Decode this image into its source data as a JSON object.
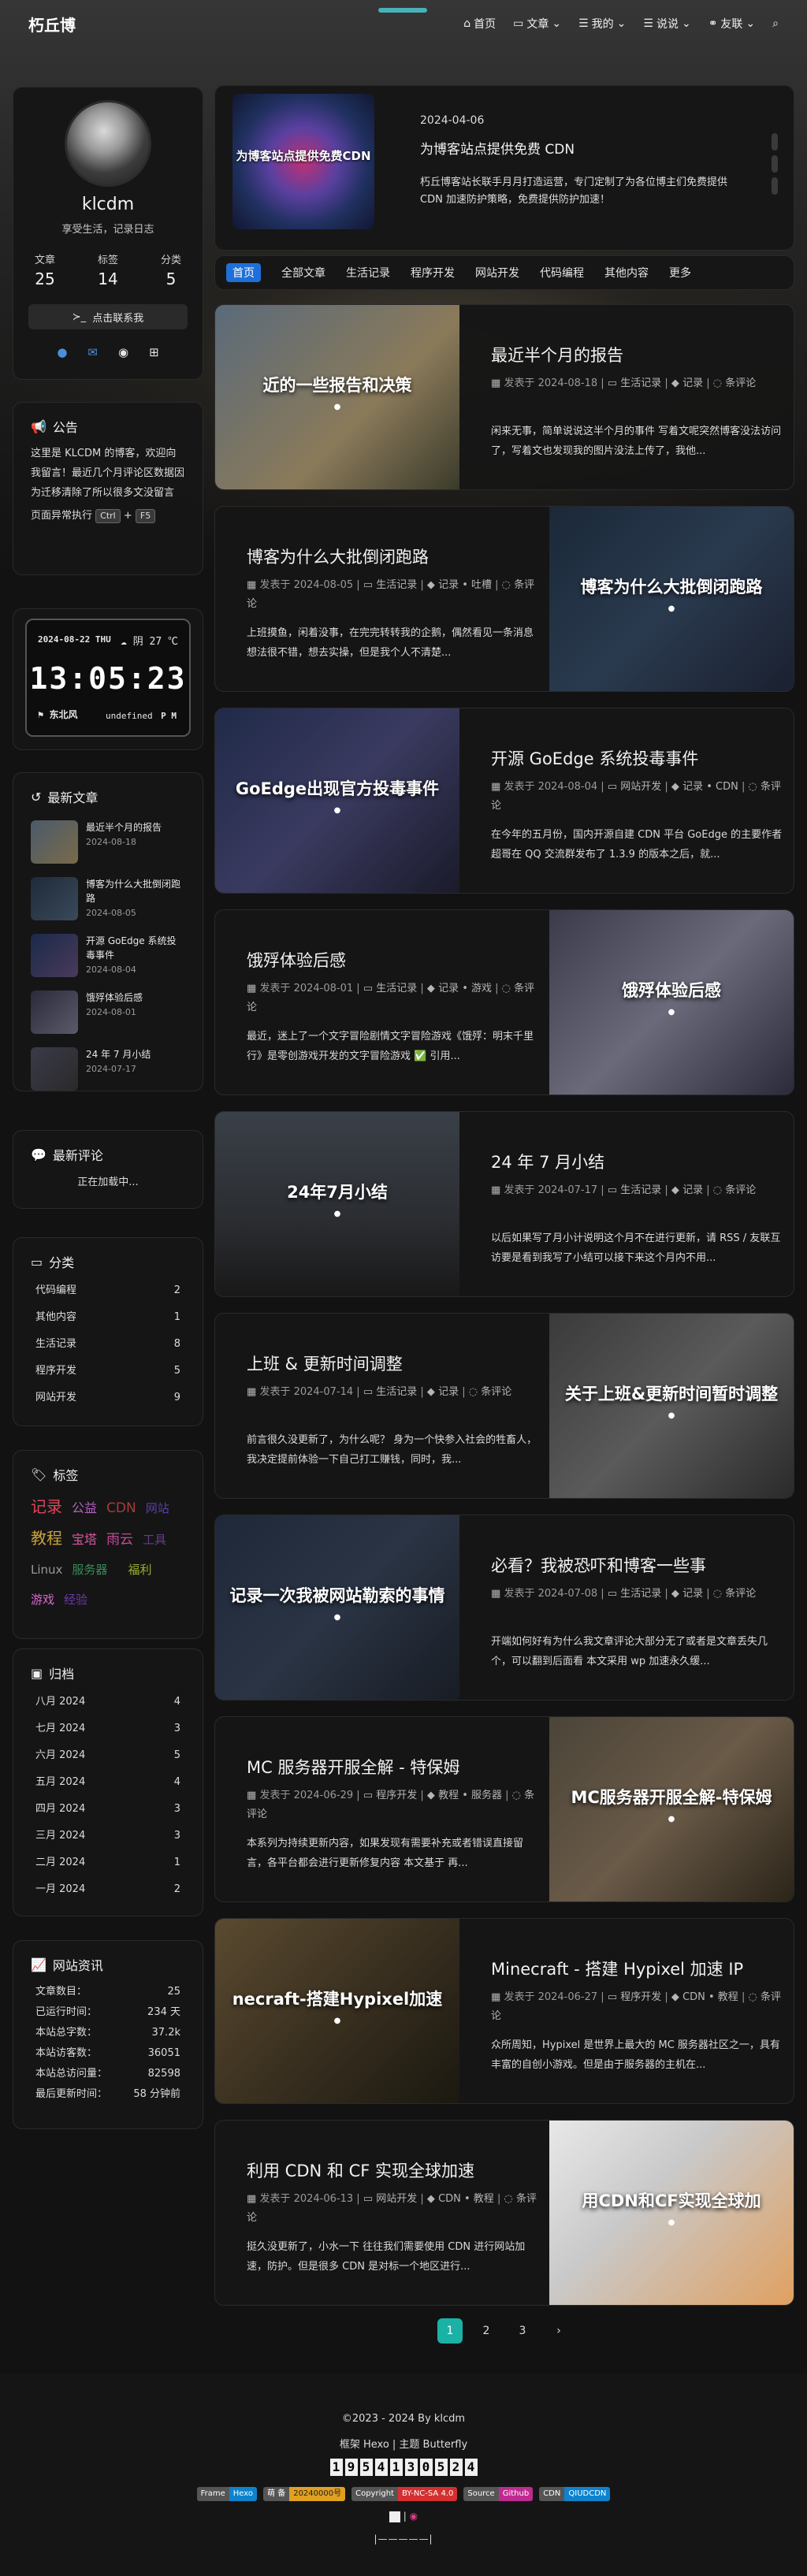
{
  "site": {
    "logo": "朽丘博"
  },
  "nav": {
    "items": [
      {
        "icon": "home-icon",
        "label": "首页"
      },
      {
        "icon": "folder-icon",
        "label": "文章"
      },
      {
        "icon": "list-icon",
        "label": "我的"
      },
      {
        "icon": "list-icon",
        "label": "说说"
      },
      {
        "icon": "link-icon",
        "label": "友联"
      }
    ]
  },
  "author": {
    "name": "klcdm",
    "desc": "享受生活，记录日志",
    "stats": [
      {
        "label": "文章",
        "value": "25"
      },
      {
        "label": "标签",
        "value": "14"
      },
      {
        "label": "分类",
        "value": "5"
      }
    ],
    "follow_label": "点击联系我"
  },
  "notice": {
    "title": "公告",
    "text": "这里是 KLCDM 的博客，欢迎向我留言！最近几个月评论区数据因为迁移清除了所以很多文没留言",
    "runtime_prefix": "页面异常执行",
    "key1": "Ctrl",
    "plus": "+",
    "key2": "F5"
  },
  "clock": {
    "date": "2024-08-22 THU",
    "weather": "阴 27 ℃",
    "time": "13:05:23",
    "wind": "东北风",
    "undef": "undefined",
    "ampm": "P M"
  },
  "recent": {
    "title": "最新文章",
    "items": [
      {
        "title": "最近半个月的报告",
        "date": "2024-08-18"
      },
      {
        "title": "博客为什么大批倒闭跑路",
        "date": "2024-08-05"
      },
      {
        "title": "开源 GoEdge 系统投毒事件",
        "date": "2024-08-04"
      },
      {
        "title": "饿殍体验后感",
        "date": "2024-08-01"
      },
      {
        "title": "24 年 7 月小结",
        "date": "2024-07-17"
      }
    ]
  },
  "comments": {
    "title": "最新评论",
    "loading": "正在加载中..."
  },
  "categories": {
    "title": "分类",
    "items": [
      {
        "name": "代码编程",
        "count": "2"
      },
      {
        "name": "其他内容",
        "count": "1"
      },
      {
        "name": "生活记录",
        "count": "8"
      },
      {
        "name": "程序开发",
        "count": "5"
      },
      {
        "name": "网站开发",
        "count": "9"
      }
    ]
  },
  "tags": {
    "title": "标签",
    "items": [
      {
        "name": "记录",
        "color": "#e0455a"
      },
      {
        "name": "公益",
        "color": "#b05fc0"
      },
      {
        "name": "CDN",
        "color": "#a83b3b"
      },
      {
        "name": "网站",
        "color": "#5b3fa8"
      },
      {
        "name": "教程",
        "color": "#c9a23a"
      },
      {
        "name": "宝塔",
        "color": "#d45aa0"
      },
      {
        "name": "雨云",
        "color": "#c34a9a"
      },
      {
        "name": "工具",
        "color": "#6a3a8a"
      },
      {
        "name": "Linux",
        "color": "#999999"
      },
      {
        "name": "服务器",
        "color": "#3a8a5a"
      },
      {
        "name": "福利",
        "color": "#9ab030"
      },
      {
        "name": "游戏",
        "color": "#d86ad0"
      },
      {
        "name": "经验",
        "color": "#6a3aa8"
      }
    ]
  },
  "archives": {
    "title": "归档",
    "items": [
      {
        "month": "八月 2024",
        "count": "4"
      },
      {
        "month": "七月 2024",
        "count": "3"
      },
      {
        "month": "六月 2024",
        "count": "5"
      },
      {
        "month": "五月 2024",
        "count": "4"
      },
      {
        "month": "四月 2024",
        "count": "3"
      },
      {
        "month": "三月 2024",
        "count": "3"
      },
      {
        "month": "二月 2024",
        "count": "1"
      },
      {
        "month": "一月 2024",
        "count": "2"
      }
    ]
  },
  "siteinfo": {
    "title": "网站资讯",
    "items": [
      {
        "label": "文章数目：",
        "value": "25"
      },
      {
        "label": "已运行时间：",
        "value": "234 天"
      },
      {
        "label": "本站总字数：",
        "value": "37.2k"
      },
      {
        "label": "本站访客数：",
        "value": "36051"
      },
      {
        "label": "本站总访问量：",
        "value": "82598"
      },
      {
        "label": "最后更新时间：",
        "value": "58 分钟前"
      }
    ]
  },
  "featured": {
    "date": "2024-04-06",
    "title": "为博客站点提供免费 CDN",
    "desc": "朽丘博客站长联手月月打造运营，专门定制了为各位博主们免费提供 CDN 加速防护策略，免费提供防护加速！",
    "image_text": "为博客站点提供免费CDN"
  },
  "catbar": [
    "首页",
    "全部文章",
    "生活记录",
    "程序开发",
    "网站开发",
    "代码编程",
    "其他内容",
    "更多"
  ],
  "posts": [
    {
      "title": "最近半个月的报告",
      "date": "2024-08-18",
      "cats": "生活记录",
      "tags": "记录",
      "comments": "条评论",
      "desc": "闲来无事，简单说说这半个月的事件 写着文呢突然博客没法访问了，写着文也发现我的图片没法上传了，我他...",
      "image_text": "近的一些报告和决策",
      "img_right": false
    },
    {
      "title": "博客为什么大批倒闭跑路",
      "date": "2024-08-05",
      "cats": "生活记录",
      "tags": "记录 • 吐槽",
      "comments": "条评论",
      "desc": "上班摸鱼，闲着没事，在完完转转我的企鹅，偶然看见一条消息 想法很不错，想去实操，但是我个人不清楚...",
      "image_text": "博客为什么大批倒闭跑路",
      "img_right": true
    },
    {
      "title": "开源 GoEdge 系统投毒事件",
      "date": "2024-08-04",
      "cats": "网站开发",
      "tags": "记录 • CDN",
      "comments": "条评论",
      "desc": "在今年的五月份，国内开源自建 CDN 平台 GoEdge 的主要作者超哥在 QQ 交流群发布了 1.3.9 的版本之后，就...",
      "image_text": "GoEdge出现官方投毒事件",
      "img_right": false
    },
    {
      "title": "饿殍体验后感",
      "date": "2024-08-01",
      "cats": "生活记录",
      "tags": "记录 • 游戏",
      "comments": "条评论",
      "desc": "最近，迷上了一个文字冒险剧情文字冒险游戏《饿殍：明末千里行》是零创游戏开发的文字冒险游戏 ✅ 引用...",
      "image_text": "饿殍体验后感",
      "img_right": true
    },
    {
      "title": "24 年 7 月小结",
      "date": "2024-07-17",
      "cats": "生活记录",
      "tags": "记录",
      "comments": "条评论",
      "desc": "以后如果写了月小计说明这个月不在进行更新，请 RSS / 友联互访要是看到我写了小结可以接下来这个月内不用...",
      "image_text": "24年7月小结",
      "img_right": false
    },
    {
      "title": "上班 & 更新时间调整",
      "date": "2024-07-14",
      "cats": "生活记录",
      "tags": "记录",
      "comments": "条评论",
      "desc": "前言很久没更新了，为什么呢？ 身为一个快参入社会的牲畜人，我决定提前体验一下自己打工赚钱，同时，我...",
      "image_text": "关于上班&更新时间暂时调整",
      "img_right": true
    },
    {
      "title": "必看？我被恐吓和博客一些事",
      "date": "2024-07-08",
      "cats": "生活记录",
      "tags": "记录",
      "comments": "条评论",
      "desc": "开端如何好有为什么我文章评论大部分无了或者是文章丢失几个，可以翻到后面看 本文采用 wp 加速永久缓...",
      "image_text": "记录一次我被网站勒索的事情",
      "img_right": false
    },
    {
      "title": "MC 服务器开服全解 - 特保姆",
      "date": "2024-06-29",
      "cats": "程序开发",
      "tags": "教程 • 服务器",
      "comments": "条评论",
      "desc": "本系列为持续更新内容，如果发现有需要补充或者错误直接留言，各平台都会进行更新修复内容 本文基于 再...",
      "image_text": "MC服务器开服全解-特保姆",
      "img_right": true
    },
    {
      "title": "Minecraft - 搭建 Hypixel 加速 IP",
      "date": "2024-06-27",
      "cats": "程序开发",
      "tags": "CDN • 教程",
      "comments": "条评论",
      "desc": "众所周知，Hypixel 是世界上最大的 MC 服务器社区之一，具有丰富的自创小游戏。但是由于服务器的主机在...",
      "image_text": "necraft-搭建Hypixel加速",
      "img_right": false
    },
    {
      "title": "利用 CDN 和 CF 实现全球加速",
      "date": "2024-06-13",
      "cats": "网站开发",
      "tags": "CDN • 教程",
      "comments": "条评论",
      "desc": "挺久没更新了，小水一下 往往我们需要使用 CDN 进行网站加速，防护。但是很多 CDN 是对标一个地区进行...",
      "image_text": "用CDN和CF实现全球加",
      "img_right": true
    }
  ],
  "post_meta": {
    "published": "发表于"
  },
  "pager": {
    "pages": [
      "1",
      "2",
      "3"
    ],
    "next": "›"
  },
  "footer": {
    "copyright": "©2023 - 2024 By klcdm",
    "framework": "框架 Hexo | 主题 Butterfly",
    "counter": [
      "1",
      "9",
      "5",
      "4",
      "1",
      "3",
      "0",
      "5",
      "2",
      "4"
    ],
    "badges": [
      {
        "l": "Frame",
        "r": "Hexo",
        "color": "#0e83cd"
      },
      {
        "l": "萌 备",
        "r": "20240000号",
        "color": "#e0a020"
      },
      {
        "l": "Copyright",
        "r": "BY-NC-SA 4.0",
        "color": "#d43030"
      },
      {
        "l": "Source",
        "r": "Github",
        "color": "#c02a90"
      },
      {
        "l": "CDN",
        "r": "QIUDCDN",
        "color": "#0e83cd"
      }
    ],
    "line5": "|",
    "line6": "|—————|"
  }
}
